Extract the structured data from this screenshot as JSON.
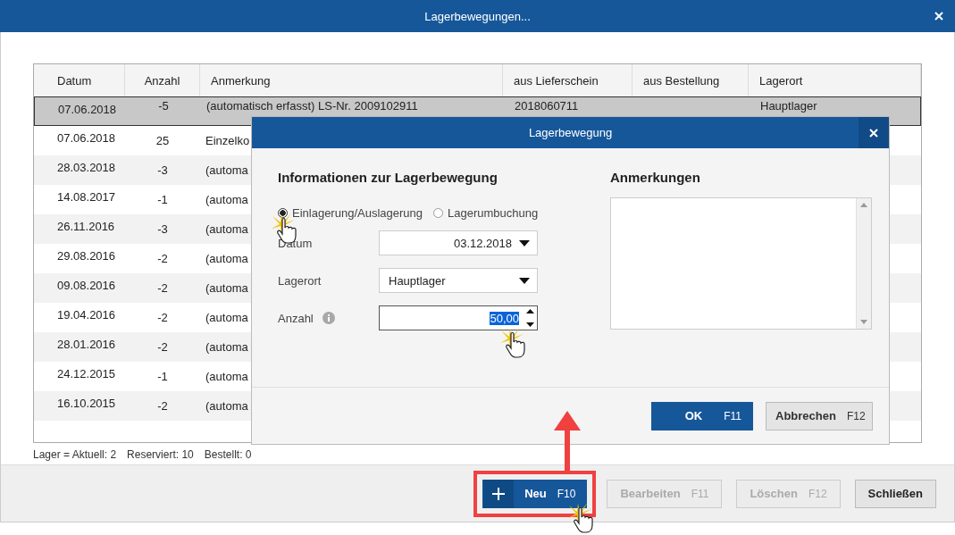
{
  "window": {
    "title": "Lagerbewegungen..."
  },
  "table": {
    "columns": [
      {
        "label": "Datum"
      },
      {
        "label": "Anzahl"
      },
      {
        "label": "Anmerkung"
      },
      {
        "label": "aus Lieferschein"
      },
      {
        "label": "aus Bestellung"
      },
      {
        "label": "Lagerort"
      }
    ],
    "rows": [
      {
        "selected": true,
        "cells": [
          "07.06.2018",
          "-5",
          "(automatisch erfasst) LS-Nr. 2009102911",
          "2018060711",
          "",
          "Hauptlager"
        ]
      },
      {
        "selected": false,
        "cells": [
          "07.06.2018",
          "25",
          "Einzelko"
        ]
      },
      {
        "selected": false,
        "cells": [
          "28.03.2018",
          "-3",
          "(automa"
        ]
      },
      {
        "selected": false,
        "cells": [
          "14.08.2017",
          "-1",
          "(automa"
        ]
      },
      {
        "selected": false,
        "cells": [
          "26.11.2016",
          "-3",
          "(automa"
        ]
      },
      {
        "selected": false,
        "cells": [
          "29.08.2016",
          "-2",
          "(automa"
        ]
      },
      {
        "selected": false,
        "cells": [
          "09.08.2016",
          "-2",
          "(automa"
        ]
      },
      {
        "selected": false,
        "cells": [
          "19.04.2016",
          "-2",
          "(automa"
        ]
      },
      {
        "selected": false,
        "cells": [
          "28.01.2016",
          "-2",
          "(automa"
        ]
      },
      {
        "selected": false,
        "cells": [
          "24.12.2015",
          "-1",
          "(automa"
        ]
      },
      {
        "selected": false,
        "cells": [
          "16.10.2015",
          "-2",
          "(automa"
        ]
      }
    ]
  },
  "status_bar": [
    "Lager = Aktuell: 2",
    "Reserviert: 10",
    "Bestellt: 0"
  ],
  "buttons": [
    {
      "kind": "primary",
      "label": "Neu",
      "shortcut": "F10",
      "disabled": false,
      "highlighted": true
    },
    {
      "kind": "normal",
      "label": "Bearbeiten",
      "shortcut": "F11",
      "disabled": true,
      "highlighted": false
    },
    {
      "kind": "normal",
      "label": "Löschen",
      "shortcut": "F12",
      "disabled": true,
      "highlighted": false
    },
    {
      "kind": "normal",
      "label": "Schließen",
      "disabled": false,
      "highlighted": false
    }
  ],
  "dialog": {
    "title": "Lagerbewegung",
    "heading": "Informationen zur Lagerbewegung",
    "radios": [
      {
        "label": "Einlagerung/Auslagerung",
        "selected": true
      },
      {
        "label": "Lagerumbuchung",
        "selected": false
      }
    ],
    "fields": [
      {
        "kind": "dropdown",
        "label": "Datum",
        "value": "03.12.2018"
      },
      {
        "kind": "dropdown",
        "label": "Lagerort",
        "value": "Hauptlager"
      },
      {
        "kind": "spinner",
        "label": "Anzahl",
        "value": "50,00",
        "info": true,
        "text_selected": true
      }
    ],
    "notes_heading": "Anmerkungen",
    "buttons": [
      {
        "kind": "primary",
        "label": "OK",
        "shortcut": "F11"
      },
      {
        "kind": "normal",
        "label": "Abbrechen",
        "shortcut": "F12"
      }
    ]
  }
}
